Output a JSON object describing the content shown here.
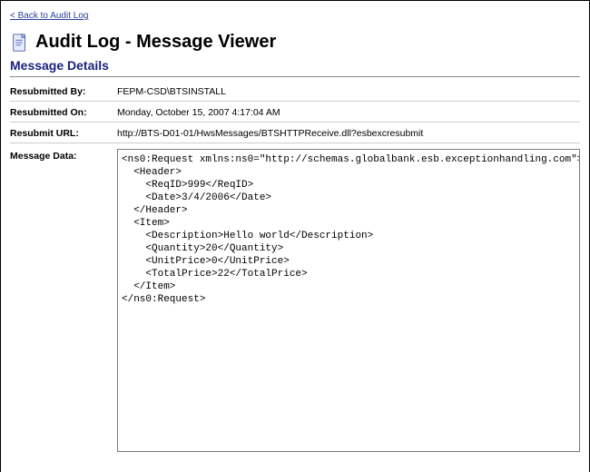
{
  "back_link": "< Back to Audit Log",
  "page_title": "Audit Log - Message Viewer",
  "section_title": "Message Details",
  "labels": {
    "resubmitted_by": "Resubmitted By:",
    "resubmitted_on": "Resubmitted On:",
    "resubmit_url": "Resubmit URL:",
    "message_data": "Message Data:"
  },
  "details": {
    "resubmitted_by": "FEPM-CSD\\BTSINSTALL",
    "resubmitted_on": "Monday, October 15, 2007 4:17:04 AM",
    "resubmit_url": "http://BTS-D01-01/HwsMessages/BTSHTTPReceive.dll?esbexcresubmit",
    "message_data": "<ns0:Request xmlns:ns0=\"http://schemas.globalbank.esb.exceptionhandling.com\">\n  <Header>\n    <ReqID>999</ReqID>\n    <Date>3/4/2006</Date>\n  </Header>\n  <Item>\n    <Description>Hello world</Description>\n    <Quantity>20</Quantity>\n    <UnitPrice>0</UnitPrice>\n    <TotalPrice>22</TotalPrice>\n  </Item>\n</ns0:Request>"
  }
}
